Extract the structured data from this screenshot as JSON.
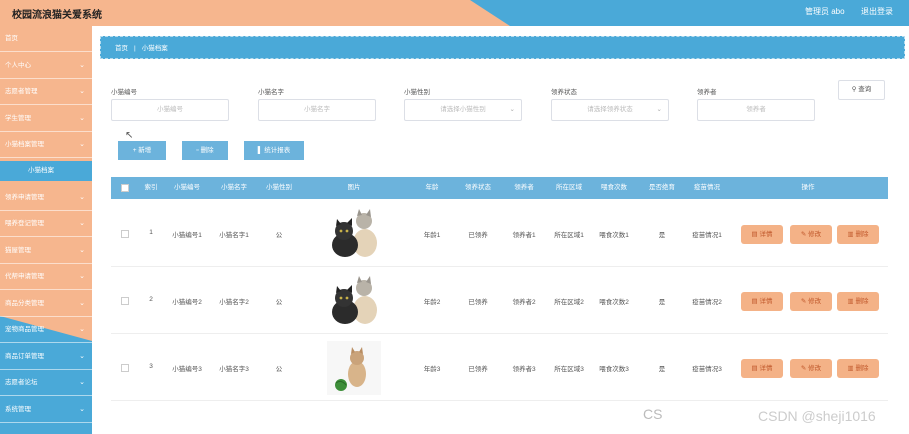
{
  "header": {
    "title": "校园流浪猫关爱系统",
    "user": "管理员 abo",
    "logout": "退出登录"
  },
  "sidebar": {
    "items": [
      {
        "label": "首页",
        "chev": false
      },
      {
        "label": "个人中心",
        "chev": true
      },
      {
        "label": "志愿者管理",
        "chev": true
      },
      {
        "label": "学生管理",
        "chev": true
      },
      {
        "label": "小猫档案管理",
        "chev": true
      },
      {
        "label": "小猫档案",
        "sub": true
      },
      {
        "label": "领养申请管理",
        "chev": true
      },
      {
        "label": "喂养登记管理",
        "chev": true
      },
      {
        "label": "猫屋管理",
        "chev": true
      },
      {
        "label": "代帮申请管理",
        "chev": true
      },
      {
        "label": "商品分类管理",
        "chev": true
      },
      {
        "label": "宠物商品管理",
        "chev": true
      },
      {
        "label": "商品订单管理",
        "chev": true
      },
      {
        "label": "志愿者论坛",
        "chev": true
      },
      {
        "label": "系统管理",
        "chev": true
      }
    ]
  },
  "breadcrumb": {
    "home": "首页",
    "sep": "|",
    "current": "小猫档案"
  },
  "search": {
    "fields": [
      {
        "label": "小猫编号",
        "placeholder": "小猫编号",
        "dropdown": false
      },
      {
        "label": "小猫名字",
        "placeholder": "小猫名字",
        "dropdown": false
      },
      {
        "label": "小猫性别",
        "placeholder": "请选择小猫性别",
        "dropdown": true
      },
      {
        "label": "领养状态",
        "placeholder": "请选择领养状态",
        "dropdown": true
      },
      {
        "label": "领养者",
        "placeholder": "领养者",
        "dropdown": false
      }
    ],
    "button": "查询"
  },
  "toolbar": {
    "add": "新增",
    "delete": "删除",
    "stats": "统计报表"
  },
  "table": {
    "headers": [
      "索引",
      "小猫编号",
      "小猫名字",
      "小猫性别",
      "图片",
      "年龄",
      "领养状态",
      "领养者",
      "所在区域",
      "喂食次数",
      "是否绝育",
      "疫苗情况",
      "操作"
    ],
    "rows": [
      {
        "index": "1",
        "no": "小猫编号1",
        "name": "小猫名字1",
        "gender": "公",
        "age": "年龄1",
        "status": "已领养",
        "adopter": "领养者1",
        "area": "所在区域1",
        "feed": "喂食次数1",
        "neutered": "是",
        "vaccine": "疫苗情况1",
        "img": "kittens"
      },
      {
        "index": "2",
        "no": "小猫编号2",
        "name": "小猫名字2",
        "gender": "公",
        "age": "年龄2",
        "status": "已领养",
        "adopter": "领养者2",
        "area": "所在区域2",
        "feed": "喂食次数2",
        "neutered": "是",
        "vaccine": "疫苗情况2",
        "img": "kittens"
      },
      {
        "index": "3",
        "no": "小猫编号3",
        "name": "小猫名字3",
        "gender": "公",
        "age": "年龄3",
        "status": "已领养",
        "adopter": "领养者3",
        "area": "所在区域3",
        "feed": "喂食次数3",
        "neutered": "是",
        "vaccine": "疫苗情况3",
        "img": "kitten-ball"
      }
    ],
    "actions": {
      "detail": "详情",
      "edit": "修改",
      "delete": "删除"
    }
  },
  "watermark": "CSDN @sheji1016",
  "watermark_left": "CS",
  "colors": {
    "accent": "#4aa9d8",
    "sidebar": "#f6b68e",
    "action": "#f4b287"
  }
}
